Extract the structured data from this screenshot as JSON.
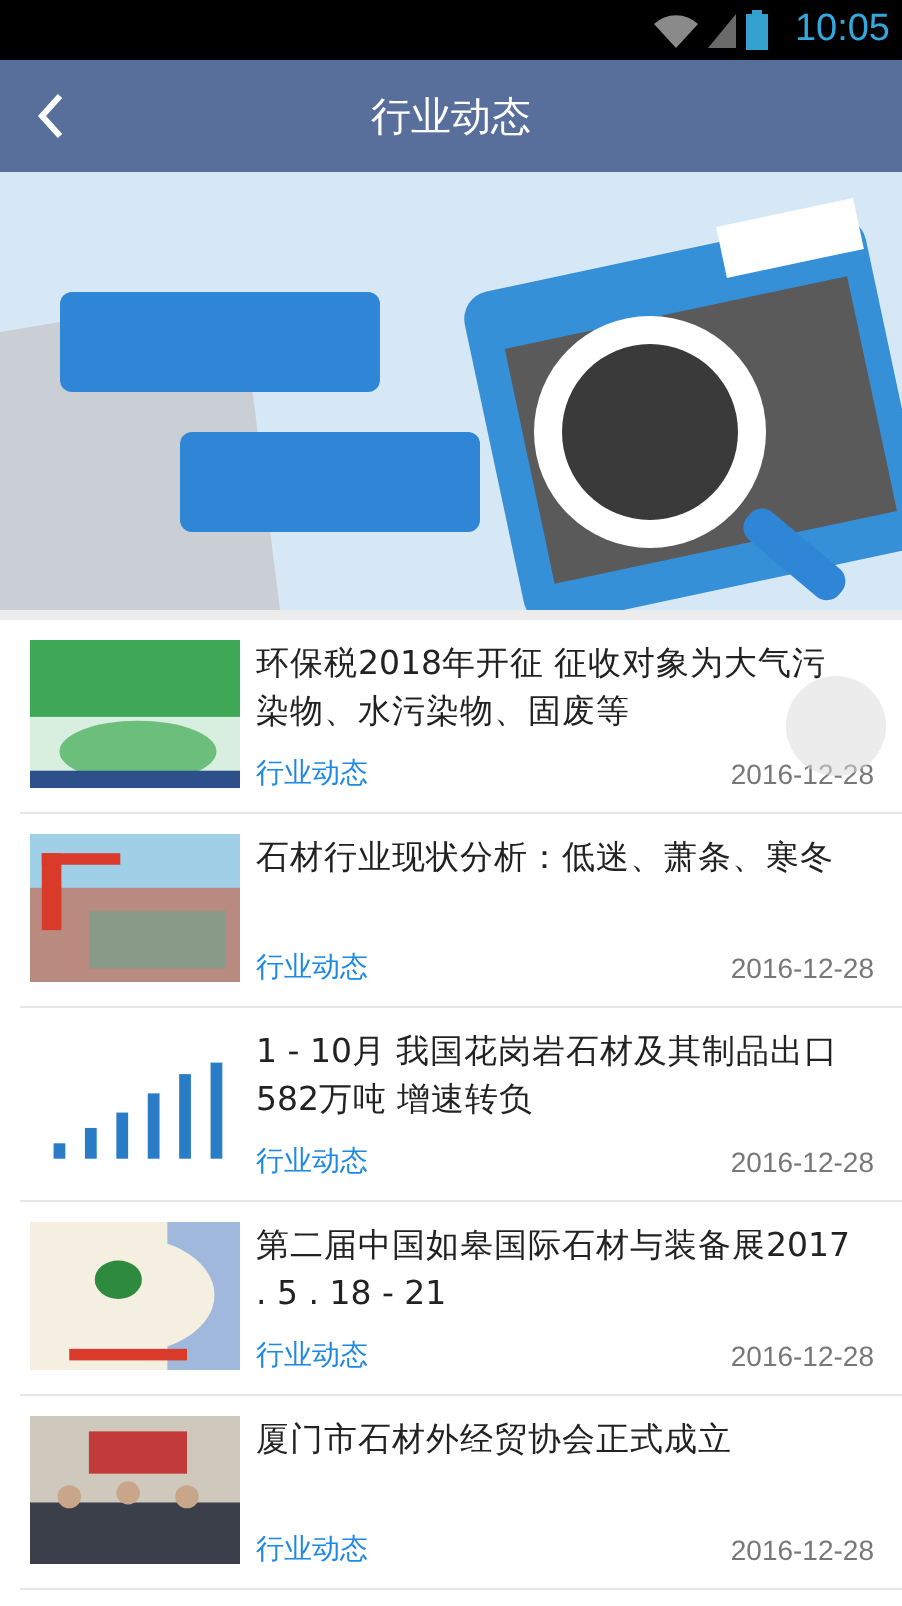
{
  "status_bar": {
    "time": "10:05"
  },
  "header": {
    "title": "行业动态"
  },
  "articles": [
    {
      "title": "环保税2018年开征 征收对象为大气污染物、水污染物、固废等",
      "category": "行业动态",
      "date": "2016-12-28"
    },
    {
      "title": "石材行业现状分析：低迷、萧条、寒冬",
      "category": "行业动态",
      "date": "2016-12-28"
    },
    {
      "title": "1 - 10月 我国花岗岩石材及其制品出口582万吨 增速转负",
      "category": "行业动态",
      "date": "2016-12-28"
    },
    {
      "title": "第二届中国如皋国际石材与装备展2017 . 5 . 18 - 21",
      "category": "行业动态",
      "date": "2016-12-28"
    },
    {
      "title": "厦门市石材外经贸协会正式成立",
      "category": "行业动态",
      "date": "2016-12-28"
    }
  ]
}
